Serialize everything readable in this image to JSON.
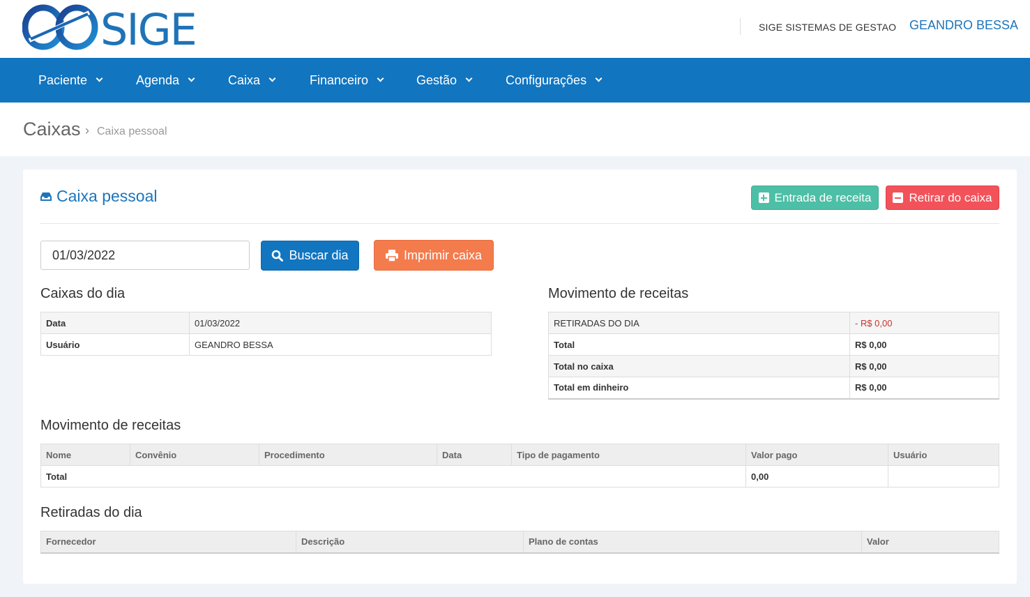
{
  "header": {
    "logo_text": "SIGE",
    "company": "SIGE SISTEMAS DE GESTAO",
    "user": "GEANDRO BESSA"
  },
  "nav": [
    {
      "label": "Paciente"
    },
    {
      "label": "Agenda"
    },
    {
      "label": "Caixa"
    },
    {
      "label": "Financeiro"
    },
    {
      "label": "Gestão"
    },
    {
      "label": "Configurações"
    }
  ],
  "breadcrumb": {
    "title": "Caixas",
    "separator": "›",
    "current": "Caixa pessoal"
  },
  "panel": {
    "title": "Caixa pessoal",
    "entrada_label": "Entrada de receita",
    "retirar_label": "Retirar do caixa",
    "date_value": "01/03/2022",
    "buscar_label": "Buscar dia",
    "imprimir_label": "Imprimir caixa"
  },
  "caixas_do_dia": {
    "heading": "Caixas do dia",
    "rows": [
      {
        "label": "Data",
        "value": "01/03/2022"
      },
      {
        "label": "Usuário",
        "value": "GEANDRO BESSA"
      }
    ]
  },
  "movimento_resumo": {
    "heading": "Movimento de receitas",
    "rows": [
      {
        "label": "RETIRADAS DO DIA",
        "value": "- R$ 0,00"
      },
      {
        "label": "Total",
        "value": "R$ 0,00"
      },
      {
        "label": "Total no caixa",
        "value": "R$ 0,00"
      },
      {
        "label": "Total em dinheiro",
        "value": "R$ 0,00"
      }
    ]
  },
  "movimento_tabela": {
    "heading": "Movimento de receitas",
    "columns": [
      "Nome",
      "Convênio",
      "Procedimento",
      "Data",
      "Tipo de pagamento",
      "Valor pago",
      "Usuário"
    ],
    "total_label": "Total",
    "total_value": "0,00"
  },
  "retiradas": {
    "heading": "Retiradas do dia",
    "columns": [
      "Fornecedor",
      "Descrição",
      "Plano de contas",
      "Valor"
    ]
  },
  "colors": {
    "primary": "#1175c0",
    "teal": "#4dbfa6",
    "red": "#f2525a",
    "orange": "#f47b4c"
  }
}
